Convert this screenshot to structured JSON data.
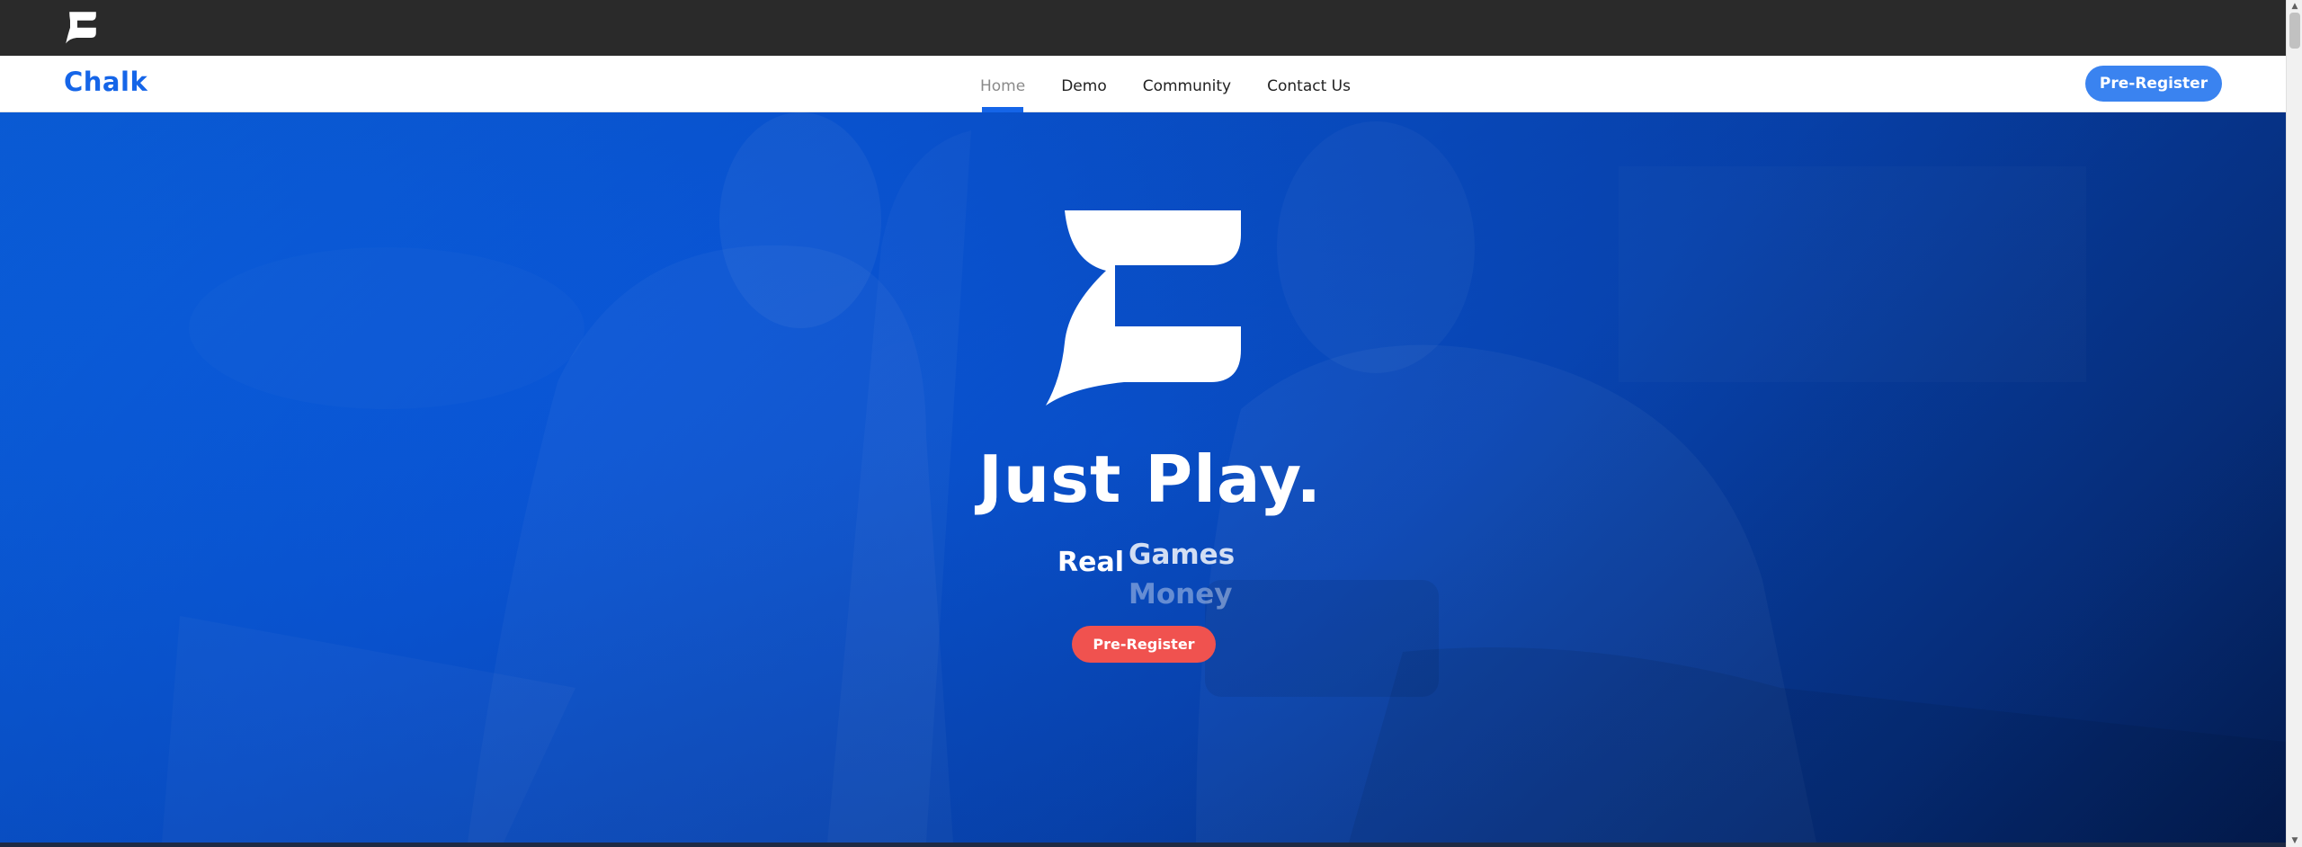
{
  "topbar": {
    "logo_icon": "chalk-e-logo-icon"
  },
  "navbar": {
    "brand": "Chalk",
    "links": [
      {
        "label": "Home",
        "active": true
      },
      {
        "label": "Demo",
        "active": false
      },
      {
        "label": "Community",
        "active": false
      },
      {
        "label": "Contact Us",
        "active": false
      }
    ],
    "cta_label": "Pre-Register"
  },
  "hero": {
    "logo_icon": "chalk-e-logo-icon",
    "title": "Just Play.",
    "rotator": {
      "static_word": "Real",
      "words": [
        "Games",
        "Money"
      ]
    },
    "cta_label": "Pre-Register"
  },
  "colors": {
    "brand_blue": "#1565e8",
    "nav_cta_blue": "#3a83f0",
    "hero_gradient_start": "#0b6cf7",
    "hero_gradient_end": "#031a4a",
    "hero_cta_red": "#f0524f",
    "topbar_dark": "#2a2a2a"
  }
}
